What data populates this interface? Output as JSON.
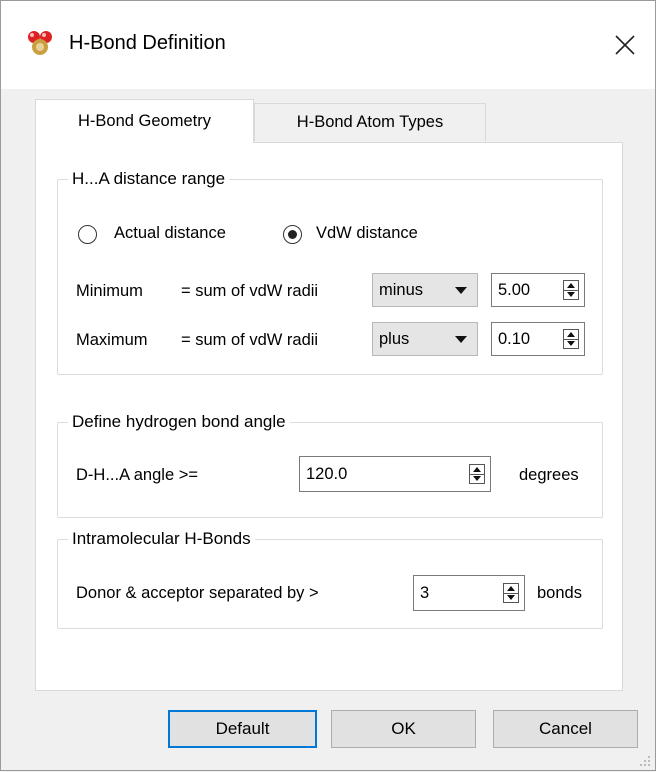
{
  "window": {
    "title": "H-Bond Definition"
  },
  "tabs": [
    {
      "label": "H-Bond Geometry",
      "active": true
    },
    {
      "label": "H-Bond Atom Types",
      "active": false
    }
  ],
  "distance_group": {
    "legend": "H...A distance range",
    "radio_actual": "Actual distance",
    "radio_vdw": "VdW distance",
    "selected": "VdW distance",
    "min_label": "Minimum",
    "min_expr": "= sum of vdW radii",
    "min_op": "minus",
    "min_value": "5.00",
    "max_label": "Maximum",
    "max_expr": "= sum of vdW radii",
    "max_op": "plus",
    "max_value": "0.10"
  },
  "angle_group": {
    "legend": "Define hydrogen bond angle",
    "label": "D-H...A angle >=",
    "value": "120.0",
    "unit": "degrees"
  },
  "intra_group": {
    "legend": "Intramolecular H-Bonds",
    "label": "Donor & acceptor separated by >",
    "value": "3",
    "unit": "bonds"
  },
  "buttons": {
    "default": "Default",
    "ok": "OK",
    "cancel": "Cancel"
  },
  "colors": {
    "focus_border": "#0078d7",
    "panel_bg": "#ffffff",
    "dialog_bg": "#f0f0f0"
  }
}
